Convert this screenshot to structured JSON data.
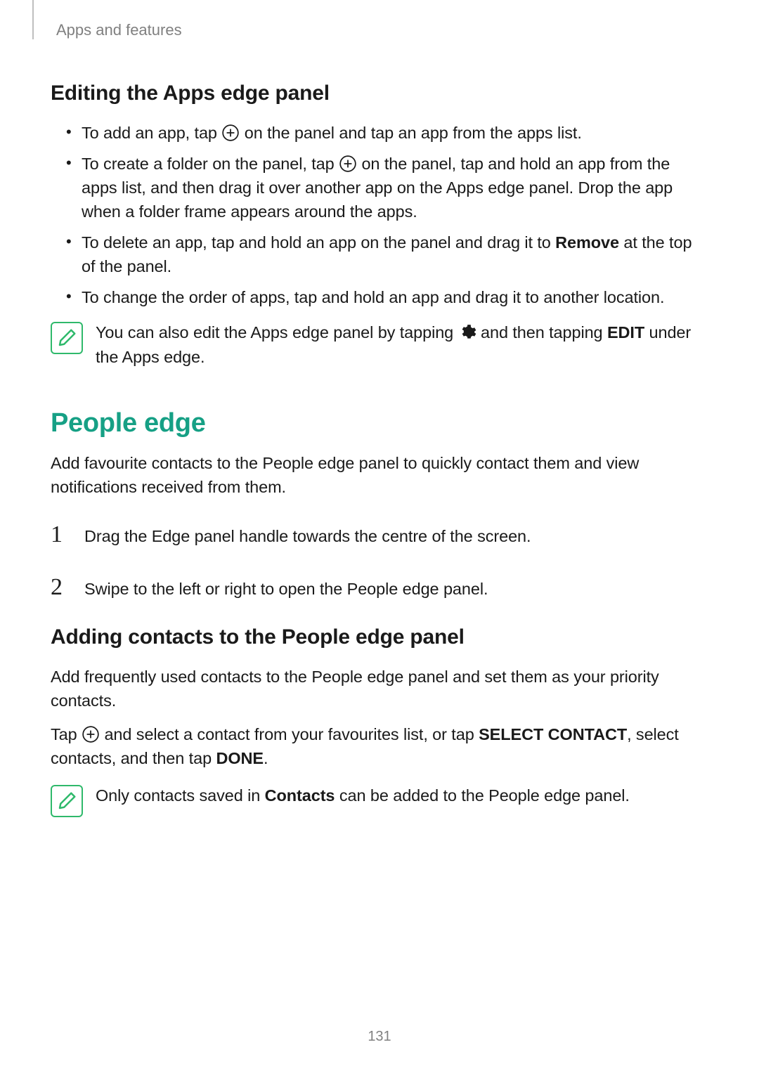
{
  "breadcrumb": "Apps and features",
  "section_editing_title": "Editing the Apps edge panel",
  "bullets": {
    "b1_pre": "To add an app, tap ",
    "b1_post": " on the panel and tap an app from the apps list.",
    "b2_pre": "To create a folder on the panel, tap ",
    "b2_post": " on the panel, tap and hold an app from the apps list, and then drag it over another app on the Apps edge panel. Drop the app when a folder frame appears around the apps.",
    "b3_pre": "To delete an app, tap and hold an app on the panel and drag it to ",
    "b3_bold": "Remove",
    "b3_post": " at the top of the panel.",
    "b4": "To change the order of apps, tap and hold an app and drag it to another location."
  },
  "note1_pre": "You can also edit the Apps edge panel by tapping ",
  "note1_mid": " and then tapping ",
  "note1_bold": "EDIT",
  "note1_post": " under the Apps edge.",
  "people_edge_title": "People edge",
  "people_edge_intro": "Add favourite contacts to the People edge panel to quickly contact them and view notifications received from them.",
  "steps": {
    "s1": "Drag the Edge panel handle towards the centre of the screen.",
    "s2": "Swipe to the left or right to open the People edge panel."
  },
  "adding_contacts_title": "Adding contacts to the People edge panel",
  "adding_contacts_intro": "Add frequently used contacts to the People edge panel and set them as your priority contacts.",
  "adding_pre": "Tap ",
  "adding_mid1": " and select a contact from your favourites list, or tap ",
  "adding_bold1": "SELECT CONTACT",
  "adding_mid2": ", select contacts, and then tap ",
  "adding_bold2": "DONE",
  "adding_post": ".",
  "note2_pre": "Only contacts saved in ",
  "note2_bold": "Contacts",
  "note2_post": " can be added to the People edge panel.",
  "page_number": "131"
}
